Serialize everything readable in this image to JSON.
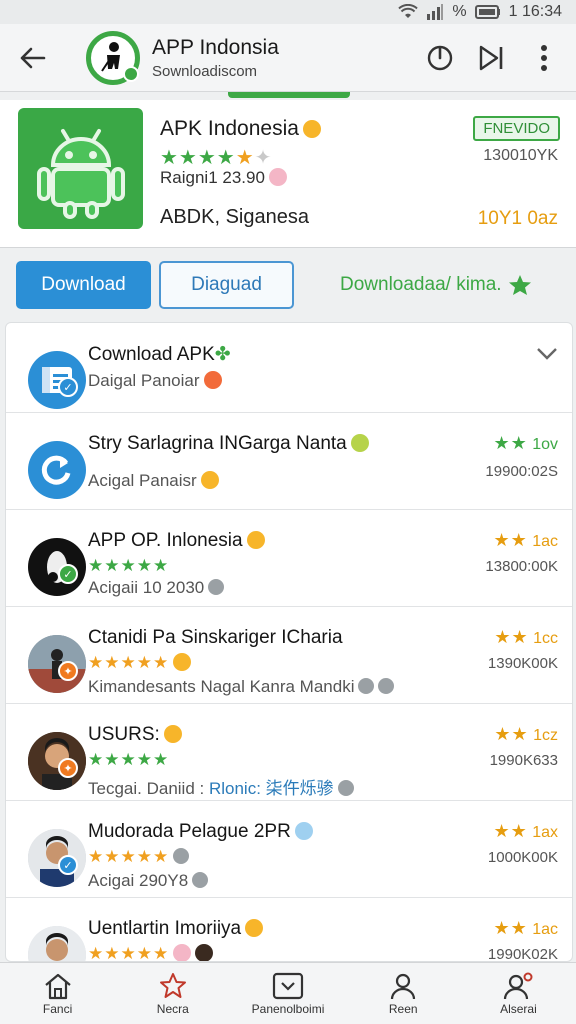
{
  "status_bar": {
    "battery": "%",
    "time": "1 16:34"
  },
  "app_bar": {
    "title": "APP Indonsia",
    "subtitle": "Sownloadiscom"
  },
  "featured": {
    "name": "APK Indonesia",
    "rating_text": "Raigni1 23.90",
    "developer": "ABDK, Siganesa",
    "badge": "FNEVIDO",
    "size": "130010YK",
    "date": "10Y1 0az"
  },
  "buttons": {
    "download": "Download",
    "secondary": "Diaguad",
    "link": "Downloadaa/ kima."
  },
  "list": [
    {
      "title": "Cownload APK",
      "sub": "Daigal Panoiar",
      "badge_color": "#2b8fd6"
    },
    {
      "title": "Stry Sarlagrina INGarga Nanta",
      "sub": "Acigal Panaisr",
      "rate": "1ov",
      "size": "19900:02S"
    },
    {
      "title": "APP OP. Inlonesia",
      "sub": "Acigaii 10 2030",
      "rate": "1ac",
      "size": "13800:00K",
      "stars": "★★★★★"
    },
    {
      "title": "Ctanidi Pa Sinskariger ICharia",
      "sub": "Kimandesants Nagal Kanra Mandki",
      "rate": "1cc",
      "size": "1390K00K",
      "stars": "★★★★★"
    },
    {
      "title": "USURS:",
      "sub": "Tecgai. Daniid :",
      "sub_extra": "Rlonic: 柒仵烁骖",
      "rate": "1cz",
      "size": "1990K633",
      "stars": "★★★★★"
    },
    {
      "title": "Mudorada Pelague 2PR",
      "sub": "Acigai 290Y8",
      "rate": "1ax",
      "size": "1000K00K",
      "stars": "★★★★★"
    },
    {
      "title": "Uentlartin Imoriiya",
      "sub": "",
      "rate": "1ac",
      "size": "1990K02K",
      "stars": "★★★★★"
    }
  ],
  "bottom_nav": [
    {
      "label": "Fanci",
      "icon": "home-icon"
    },
    {
      "label": "Necra",
      "icon": "star-icon"
    },
    {
      "label": "Panenolboimi",
      "icon": "download-box-icon"
    },
    {
      "label": "Reen",
      "icon": "person-icon"
    },
    {
      "label": "Alserai",
      "icon": "person-alert-icon"
    }
  ],
  "colors": {
    "accent_green": "#3da845",
    "accent_blue": "#2b8fd6",
    "accent_orange": "#e69d10"
  }
}
